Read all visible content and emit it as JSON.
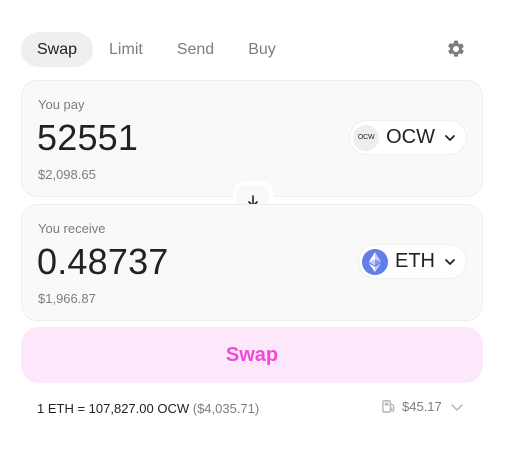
{
  "tabs": [
    {
      "label": "Swap",
      "active": true
    },
    {
      "label": "Limit",
      "active": false
    },
    {
      "label": "Send",
      "active": false
    },
    {
      "label": "Buy",
      "active": false
    }
  ],
  "settings_icon": "gear-icon",
  "pay": {
    "label": "You pay",
    "amount": "52551",
    "usd_value": "$2,098.65",
    "token": {
      "symbol": "OCW",
      "icon_text": "OCW",
      "icon_bg": "#eeeeee"
    }
  },
  "receive": {
    "label": "You receive",
    "amount": "0.48737",
    "usd_value": "$1,966.87",
    "token": {
      "symbol": "ETH",
      "icon": "ethereum-icon",
      "icon_bg": "#627eea"
    }
  },
  "switch_icon": "arrow-down-icon",
  "swap_button": {
    "label": "Swap",
    "bg": "#fde8fb",
    "text_color": "#f24ad8"
  },
  "footer": {
    "rate": "1 ETH = 107,827.00 OCW",
    "rate_usd": "($4,035.71)",
    "gas_icon": "gas-pump-icon",
    "gas_fee": "$45.17"
  }
}
